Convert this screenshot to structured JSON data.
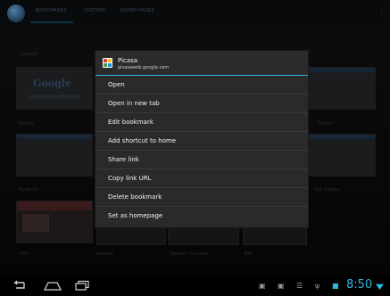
{
  "browser": {
    "tabs": [
      "BOOKMARKS",
      "HISTORY",
      "SAVED PAGES"
    ],
    "folder_path": "< Local",
    "thumbnails": [
      {
        "label": "Google",
        "logo": "Google"
      },
      {
        "label": "Picasa"
      },
      {
        "label": "Twitter"
      },
      {
        "label": "Facebook"
      },
      {
        "label": "Wikipedia"
      },
      {
        "label": "eBay"
      },
      {
        "label": "Ask Toolbar"
      },
      {
        "label": "CNN"
      },
      {
        "label": "Amazon"
      },
      {
        "label": "Weather Channel"
      },
      {
        "label": "BBC"
      }
    ]
  },
  "context_menu": {
    "title": "Picasa",
    "url": "picasaweb.google.com",
    "items": [
      "Open",
      "Open in new tab",
      "Edit bookmark",
      "Add shortcut to home",
      "Share link",
      "Copy link URL",
      "Delete bookmark",
      "Set as homepage"
    ]
  },
  "system_bar": {
    "time": "8:50",
    "icons": [
      "back-icon",
      "home-icon",
      "recent-apps-icon",
      "notification-icon",
      "usb-icon",
      "signal-icon",
      "wifi-icon"
    ],
    "accent": "#33b5e5"
  }
}
